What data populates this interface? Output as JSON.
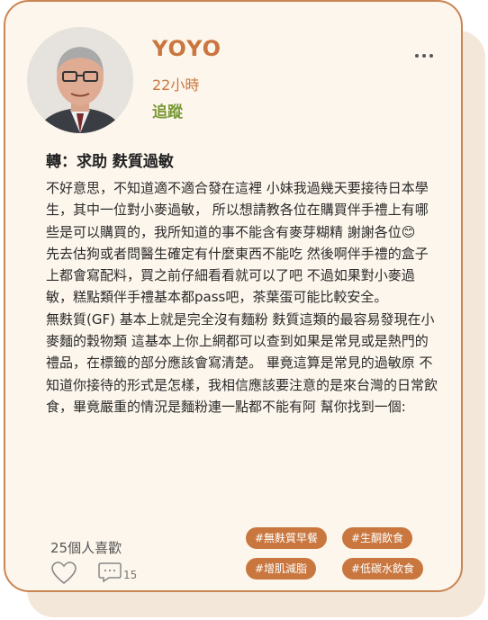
{
  "post": {
    "username": "YOYO",
    "time": "22小時",
    "follow_label": "追蹤",
    "title": "轉：求助 麩質過敏",
    "body": "不好意思，不知道適不適合發在這裡 小妹我過幾天要接待日本學生，其中一位對小麥過敏， 所以想請教各位在購買伴手禮上有哪些是可以購買的，我所知道的事不能含有麥芽糊精 謝謝各位😊\n先去估狗或者問醫生確定有什麼東西不能吃 然後啊伴手禮的盒子上都會寫配料，買之前仔細看看就可以了吧 不過如果對小麥過敏，糕點類伴手禮基本都pass吧，茶葉蛋可能比較安全。\n無麩質(GF) 基本上就是完全沒有麵粉 麩質這類的最容易發現在小麥麵的穀物類 這基本上你上網都可以查到如果是常見或是熱門的禮品，在標籤的部分應該會寫清楚。 畢竟這算是常見的過敏原 不知道你接待的形式是怎樣，我相信應該要注意的是來台灣的日常飲食，畢竟嚴重的情況是麵粉連一點都不能有阿 幫你找到一個:",
    "likes_text": "25個人喜歡",
    "comment_count": "15",
    "tags": [
      "#無麩質早餐",
      "#生酮飲食",
      "#增肌減脂",
      "#低碳水飲食"
    ]
  },
  "icons": {
    "more": "more-dots-icon",
    "heart": "heart-icon",
    "comment": "comment-icon"
  },
  "colors": {
    "accent": "#c9773f",
    "follow": "#7a9a38",
    "card_bg": "#fdf6ec",
    "card_border": "#c98553",
    "tag_bg": "#c9773f"
  }
}
